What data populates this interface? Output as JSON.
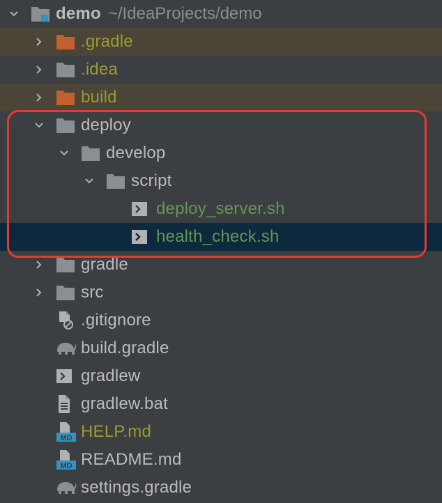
{
  "project": {
    "name": "demo",
    "path": "~/IdeaProjects/demo"
  },
  "colors": {
    "background": "#3c3f41",
    "excluded_row": "#4a4536",
    "selected_row": "#0d293e",
    "folder_default": "#8a8f93",
    "folder_excluded": "#c0612f",
    "text_default": "#bbbbbb",
    "text_excluded": "#9e9a2f",
    "text_new": "#629755",
    "highlight_border": "#e43a2f"
  },
  "items": [
    {
      "label": ".gradle",
      "icon": "folder-excluded-icon"
    },
    {
      "label": ".idea",
      "icon": "folder-icon"
    },
    {
      "label": "build",
      "icon": "folder-excluded-icon"
    },
    {
      "label": "deploy",
      "icon": "folder-icon"
    },
    {
      "label": "develop",
      "icon": "folder-icon"
    },
    {
      "label": "script",
      "icon": "folder-icon"
    },
    {
      "label": "deploy_server.sh",
      "icon": "shell-script-icon"
    },
    {
      "label": "health_check.sh",
      "icon": "shell-script-icon"
    },
    {
      "label": "gradle",
      "icon": "folder-icon"
    },
    {
      "label": "src",
      "icon": "folder-icon"
    },
    {
      "label": ".gitignore",
      "icon": "ignored-file-icon"
    },
    {
      "label": "build.gradle",
      "icon": "gradle-elephant-icon"
    },
    {
      "label": "gradlew",
      "icon": "shell-script-icon"
    },
    {
      "label": "gradlew.bat",
      "icon": "text-file-icon"
    },
    {
      "label": "HELP.md",
      "icon": "markdown-file-icon"
    },
    {
      "label": "README.md",
      "icon": "markdown-file-icon"
    },
    {
      "label": "settings.gradle",
      "icon": "gradle-elephant-icon"
    }
  ]
}
